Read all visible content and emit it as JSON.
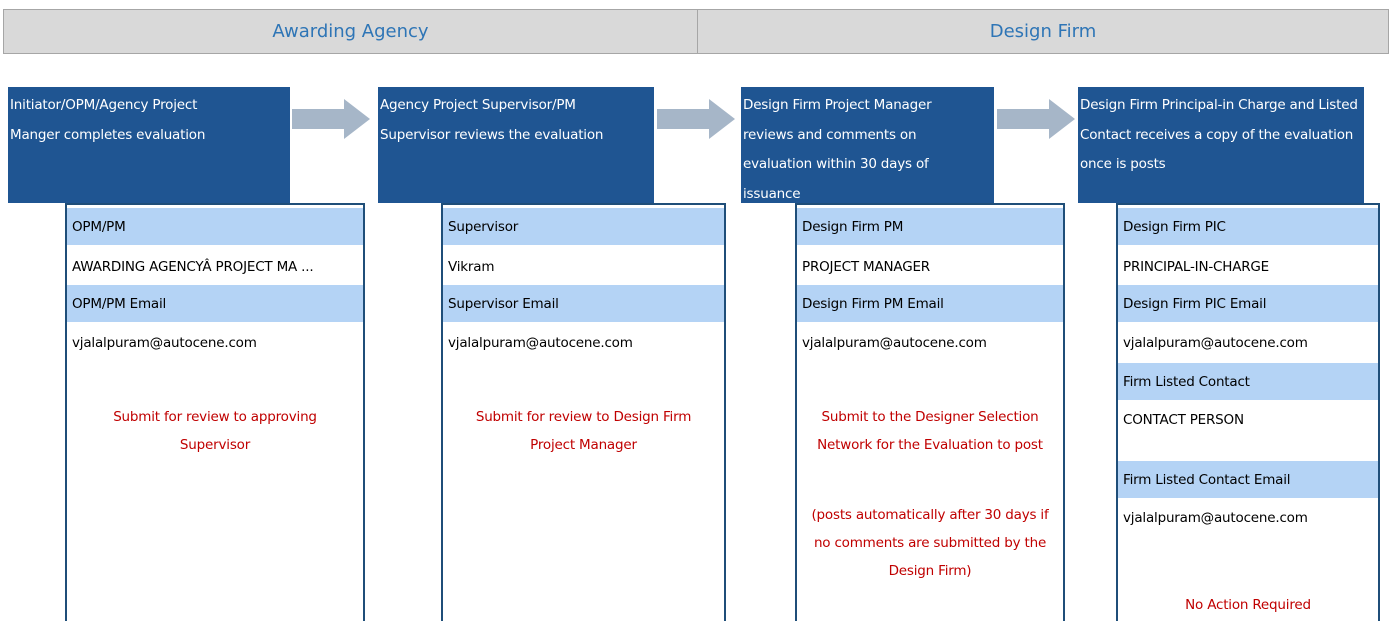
{
  "headers": {
    "awarding_agency": "Awarding Agency",
    "design_firm": "Design Firm"
  },
  "steps": [
    {
      "text": "Initiator/OPM/Agency Project Manger completes evaluation"
    },
    {
      "text": "Agency Project Supervisor/PM Supervisor reviews the evaluation"
    },
    {
      "text": "Design Firm Project Manager reviews and comments on evaluation within 30 days of issuance"
    },
    {
      "text": "Design Firm Principal-in Charge and Listed Contact receives a copy of the evaluation once is posts"
    }
  ],
  "cards": [
    {
      "fields": [
        "OPM/PM",
        "AWARDING AGENCYÂ PROJECT MA ...",
        "OPM/PM Email",
        "vjalalpuram@autocene.com"
      ],
      "note": "Submit for review to approving Supervisor"
    },
    {
      "fields": [
        "Supervisor",
        "Vikram",
        "Supervisor Email",
        "vjalalpuram@autocene.com"
      ],
      "note": "Submit for review to Design Firm Project Manager"
    },
    {
      "fields": [
        "Design Firm PM",
        "PROJECT MANAGER",
        "Design Firm PM Email",
        "vjalalpuram@autocene.com"
      ],
      "note": "Submit to the Designer Selection Network for the Evaluation to post",
      "note2": "(posts automatically after 30 days if no comments are submitted by the Design Firm)"
    },
    {
      "fields": [
        "Design Firm PIC",
        "PRINCIPAL-IN-CHARGE",
        "Design Firm PIC Email",
        "vjalalpuram@autocene.com",
        "Firm Listed Contact",
        "CONTACT PERSON",
        "Firm Listed Contact Email",
        "vjalalpuram@autocene.com"
      ],
      "note": "No Action Required"
    }
  ],
  "colors": {
    "step_bg": "#1f5592",
    "band_bg": "#b4d3f5",
    "note_text": "#c00000",
    "header_text": "#2e75b6",
    "arrow": "#a6b6c8"
  }
}
